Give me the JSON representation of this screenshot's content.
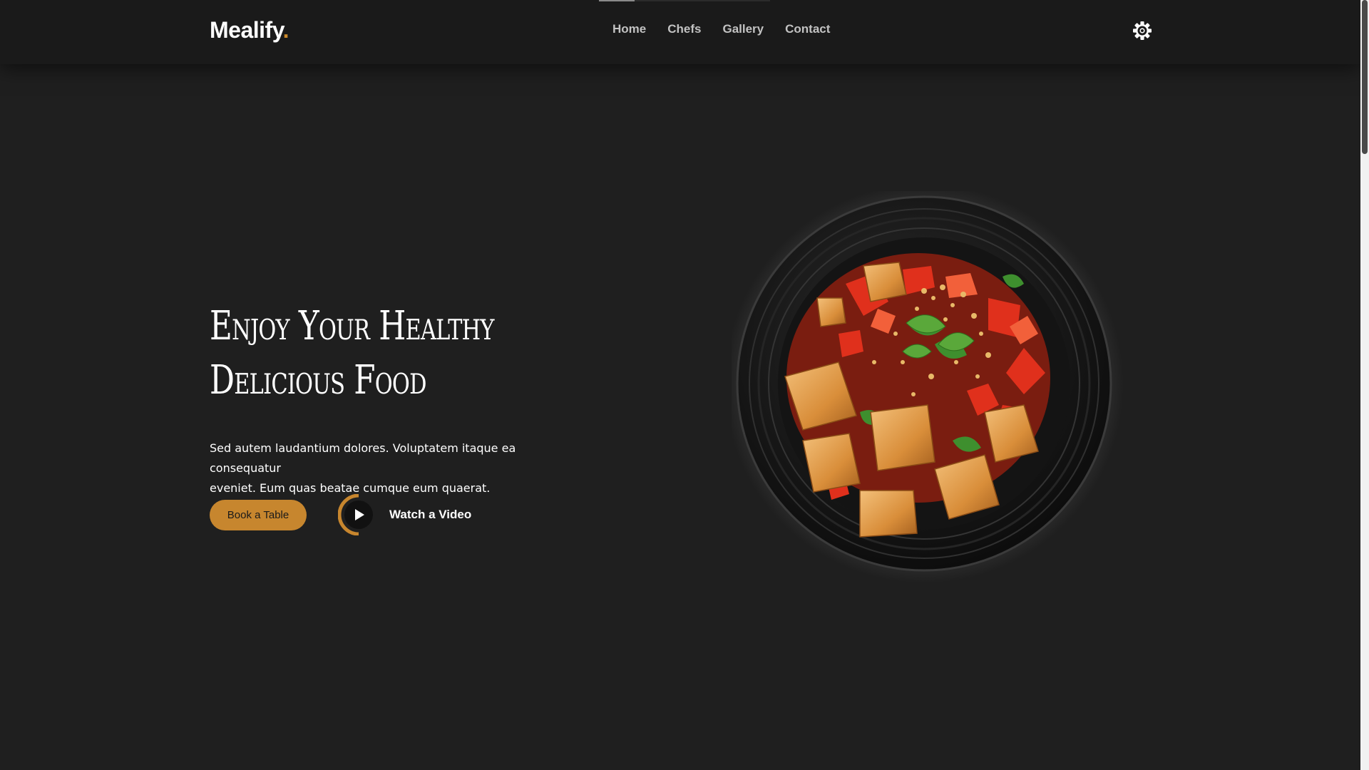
{
  "brand": {
    "name": "Mealify",
    "dot": ".",
    "accent_color": "#cd8a2b"
  },
  "nav": {
    "items": [
      {
        "label": "Home"
      },
      {
        "label": "Chefs"
      },
      {
        "label": "Gallery"
      },
      {
        "label": "Contact"
      }
    ],
    "settings_icon": "gear-icon"
  },
  "hero": {
    "title_line1": "Enjoy Your Healthy",
    "title_line2": "Delicious Food",
    "text_line1": "Sed autem laudantium dolores. Voluptatem itaque ea consequatur",
    "text_line2": "eveniet. Eum quas beatae cumque eum quaerat.",
    "book_button": "Book a Table",
    "watch_label": "Watch a Video",
    "play_icon": "play-icon",
    "dish_image": "food-plate-image"
  },
  "colors": {
    "background": "#1f1f1f",
    "header": "#1a1a1a",
    "button": "#c7862e"
  }
}
